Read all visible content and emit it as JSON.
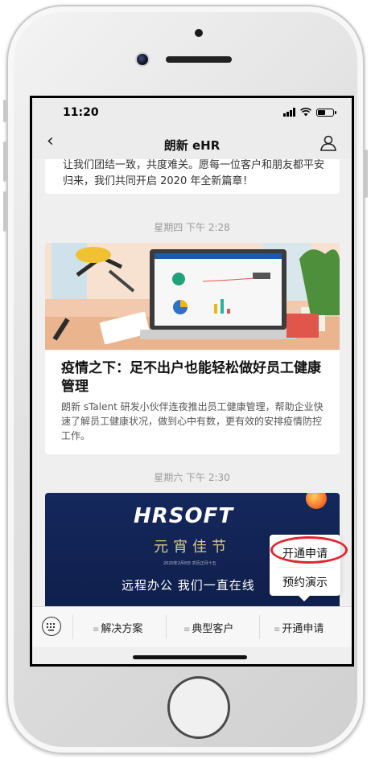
{
  "status_bar": {
    "time": "11:20"
  },
  "navbar": {
    "back_icon": "chevron-left-icon",
    "title": "朗新 eHR",
    "profile_icon": "person-icon"
  },
  "feed": {
    "card1": {
      "text": "让我们团结一致，共度难关。愿每一位客户和朋友都平安归来，我们共同开启 2020 年全新篇章！"
    },
    "timestamp1": "星期四 下午 2:28",
    "card2": {
      "title": "疫情之下：足不出户也能轻松做好员工健康管理",
      "body": "朗新 sTalent 研发小伙伴连夜推出员工健康管理，帮助企业快速了解员工健康状况，做到心中有数，更有效的安排疫情防控工作。"
    },
    "timestamp2": "星期六 下午 2:30",
    "card3": {
      "brand": "HRSOFT",
      "festival": "元宵佳节",
      "date_line": "2020年2月8日 农历正月十五",
      "slogan": "远程办公 我们一直在线"
    }
  },
  "popup_menu": {
    "option1": "开通申请",
    "option2": "预约演示"
  },
  "bottom_menu": {
    "keyboard_icon": "keyboard-icon",
    "items": [
      {
        "label": "解决方案"
      },
      {
        "label": "典型客户"
      },
      {
        "label": "开通申请"
      }
    ]
  },
  "colors": {
    "highlight": "#e0262e",
    "banner_bg": "#15285c"
  }
}
